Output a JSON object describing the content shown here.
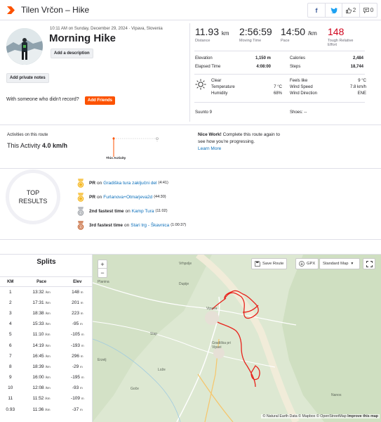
{
  "header": {
    "title": "Tilen Vrčon – Hike",
    "kudos_count": "2",
    "comment_count": "0",
    "logo_icon": "strava-chevron-icon"
  },
  "activity": {
    "datetime": "10:11 AM on Sunday, December 29, 2024 · Vipava, Slovenia",
    "name": "Morning Hike",
    "add_description": "Add a description",
    "add_private_notes": "Add private notes",
    "friends_prompt": "With someone who didn't record?",
    "add_friends": "Add Friends"
  },
  "stats": {
    "distance": {
      "value": "11.93",
      "unit": "km",
      "label": "Distance"
    },
    "moving_time": {
      "value": "2:56:59",
      "label": "Moving Time"
    },
    "pace": {
      "value": "14:50",
      "unit": "/km",
      "label": "Pace"
    },
    "relative_effort": {
      "value": "148",
      "label": "Tough Relative Effort"
    },
    "elevation": {
      "label": "Elevation",
      "value": "1,150 m"
    },
    "calories": {
      "label": "Calories",
      "value": "2,484"
    },
    "elapsed": {
      "label": "Elapsed Time",
      "value": "4:08:00"
    },
    "steps": {
      "label": "Steps",
      "value": "18,744"
    }
  },
  "weather": {
    "condition": "Clear",
    "temperature_label": "Temperature",
    "temperature": "7 °C",
    "humidity_label": "Humidity",
    "humidity": "68%",
    "feels_like_label": "Feels like",
    "feels_like": "9 °C",
    "wind_speed_label": "Wind Speed",
    "wind_speed": "7.8 km/h",
    "wind_dir_label": "Wind Direction",
    "wind_dir": "ENE"
  },
  "gear": {
    "device": "Suunto 9",
    "shoes": "Shoes: --"
  },
  "route": {
    "label": "Activities on this route",
    "this_prefix": "This Activity",
    "this_value": "4.0 km/h",
    "chart_caption": "This Activity",
    "nice_bold": "Nice Work!",
    "nice_text": "Complete this route again to see how you're progressing.",
    "learn_more": "Learn More"
  },
  "top_results": {
    "title_line1": "TOP",
    "title_line2": "RESULTS",
    "items": [
      {
        "rank": "PR",
        "on": "on",
        "segment": "Gradiška tura zaključni del",
        "time": "(4:41)",
        "medal": "gold",
        "medal_label": ""
      },
      {
        "rank": "PR",
        "on": "on",
        "segment": "Furlanova+Otmarjeva2d",
        "time": "(44:30)",
        "medal": "gold",
        "medal_label": ""
      },
      {
        "rank": "2nd fastest time",
        "on": "on",
        "segment": "Kamp Tura",
        "time": "(11:02)",
        "medal": "silver",
        "medal_label": "2"
      },
      {
        "rank": "3rd fastest time",
        "on": "on",
        "segment": "Stari trg - Škavnica",
        "time": "(1:00:37)",
        "medal": "bronze",
        "medal_label": "3"
      }
    ]
  },
  "splits": {
    "title": "Splits",
    "headers": [
      "KM",
      "Pace",
      "Elev"
    ],
    "pace_unit": "/km",
    "elev_unit": "m",
    "rows": [
      {
        "km": "1",
        "pace": "13:32",
        "elev": "148"
      },
      {
        "km": "2",
        "pace": "17:31",
        "elev": "201"
      },
      {
        "km": "3",
        "pace": "18:38",
        "elev": "223"
      },
      {
        "km": "4",
        "pace": "15:33",
        "elev": "-95"
      },
      {
        "km": "5",
        "pace": "11:10",
        "elev": "-105"
      },
      {
        "km": "6",
        "pace": "14:19",
        "elev": "-193"
      },
      {
        "km": "7",
        "pace": "16:45",
        "elev": "296"
      },
      {
        "km": "8",
        "pace": "18:39",
        "elev": "-29"
      },
      {
        "km": "9",
        "pace": "16:00",
        "elev": "-195"
      },
      {
        "km": "10",
        "pace": "12:08",
        "elev": "-93"
      },
      {
        "km": "11",
        "pace": "11:52",
        "elev": "-109"
      },
      {
        "km": "0.93",
        "pace": "11:36",
        "elev": "-37"
      }
    ]
  },
  "map": {
    "zoom_in": "+",
    "zoom_out": "−",
    "save_route": "Save Route",
    "gpx": "GPX",
    "map_style": "Standard Map",
    "attribution": "© Natural Earth Data © Mapbox © OpenStreetMap",
    "improve": "Improve this map",
    "places": [
      "Vrhpolje",
      "Dupije",
      "Planina",
      "Vipava",
      "Slap",
      "Gradiška pri Vipavi",
      "Erzelj",
      "Lože",
      "Goče",
      "Nanos"
    ]
  }
}
